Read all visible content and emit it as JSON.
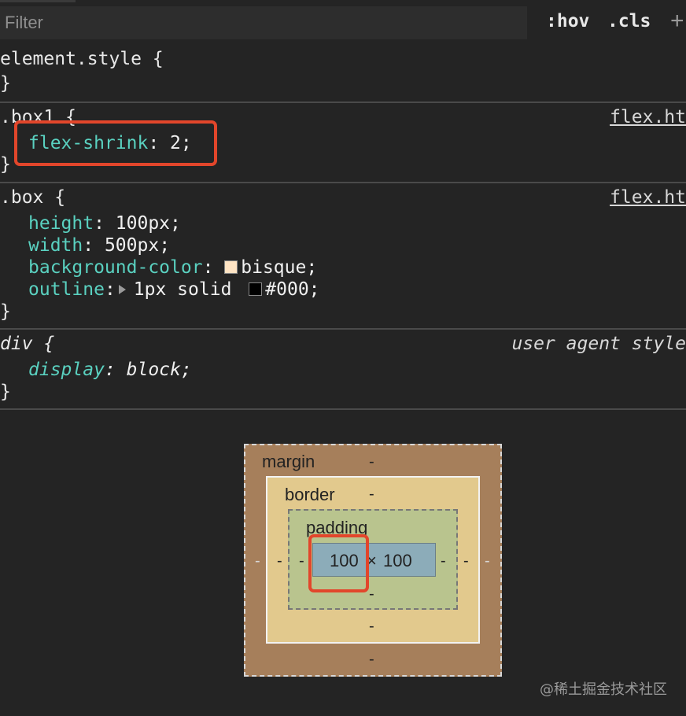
{
  "toolbar": {
    "filter_placeholder": "Filter",
    "hov_label": ":hov",
    "cls_label": ".cls",
    "add_label": "+"
  },
  "rules": {
    "element_style": {
      "open": "element.style {",
      "close": "}"
    },
    "box1": {
      "open": ".box1 {",
      "source": "flex.ht",
      "prop": "flex-shrink",
      "value": "2;",
      "close": "}"
    },
    "box": {
      "open": ".box {",
      "source": "flex.ht",
      "decls": [
        {
          "prop": "height",
          "value": "100px;"
        },
        {
          "prop": "width",
          "value": "500px;"
        },
        {
          "prop": "background-color",
          "value": "bisque;"
        },
        {
          "prop": "outline",
          "value": "1px solid ",
          "value2": "#000;"
        }
      ],
      "close": "}"
    },
    "div": {
      "open": "div {",
      "source": "user agent style",
      "prop": "display",
      "value": "block;",
      "close": "}"
    }
  },
  "colors": {
    "bisque": "#ffe4c4",
    "black": "#000000",
    "highlight": "#e2462b"
  },
  "box_model": {
    "margin_label": "margin",
    "border_label": "border",
    "padding_label": "padding",
    "width": "100",
    "times": "×",
    "height": "100",
    "dash": "-"
  },
  "watermark": "@稀土掘金技术社区"
}
